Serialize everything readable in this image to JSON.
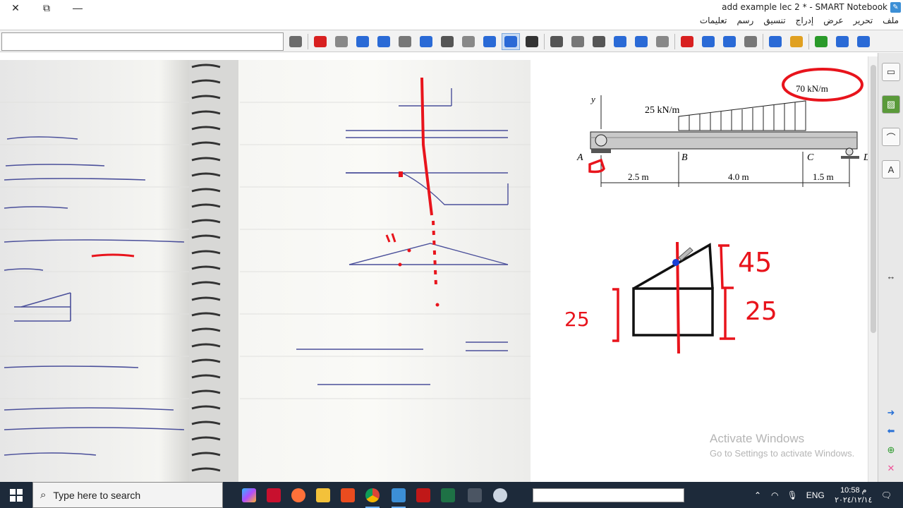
{
  "window": {
    "title": "add example lec 2 * - SMART Notebook",
    "controls": [
      "✕",
      "⧉",
      "—"
    ]
  },
  "menu": [
    "ملف",
    "تحرير",
    "عرض",
    "إدراج",
    "تنسيق",
    "رسم",
    "تعليمات"
  ],
  "toolbar_icons": [
    "resize-icon",
    "text-icon",
    "pen-icon",
    "fill-icon",
    "magic-pen-icon",
    "highlighter-icon",
    "shapes-icon",
    "line-icon",
    "eraser-icon",
    "creative-pen-icon",
    "pen-active-icon",
    "select-icon",
    "table-icon",
    "screen-shade-icon",
    "capture-icon",
    "document-camera-icon",
    "display-icon",
    "projector-icon",
    "delete-icon",
    "undo-icon",
    "redo-icon",
    "paste-icon",
    "save-icon",
    "open-icon",
    "add-page-icon",
    "previous-page-icon",
    "next-page-icon"
  ],
  "diagram": {
    "y_axis": "y",
    "load_left": "25 kN/m",
    "load_right": "70 kN/m",
    "point_a": "A",
    "point_b": "B",
    "point_c": "C",
    "point_d": "D",
    "dim_ab": "2.5 m",
    "dim_bc": "4.0 m",
    "dim_cd": "1.5 m"
  },
  "handwriting": {
    "right_45": "45",
    "right_25": "25",
    "right_left_25": "25"
  },
  "watermark": {
    "line1": "Activate Windows",
    "line2": "Go to Settings to activate Windows."
  },
  "taskbar": {
    "search_placeholder": "Type here to search",
    "lang": "ENG",
    "time": "10:58 م",
    "date": "٢٠٢٤/١٢/١٤"
  },
  "colors": {
    "accent_red": "#e8141c",
    "taskbar_bg": "#1d2a3a",
    "blue_dot": "#1a3fd6"
  }
}
